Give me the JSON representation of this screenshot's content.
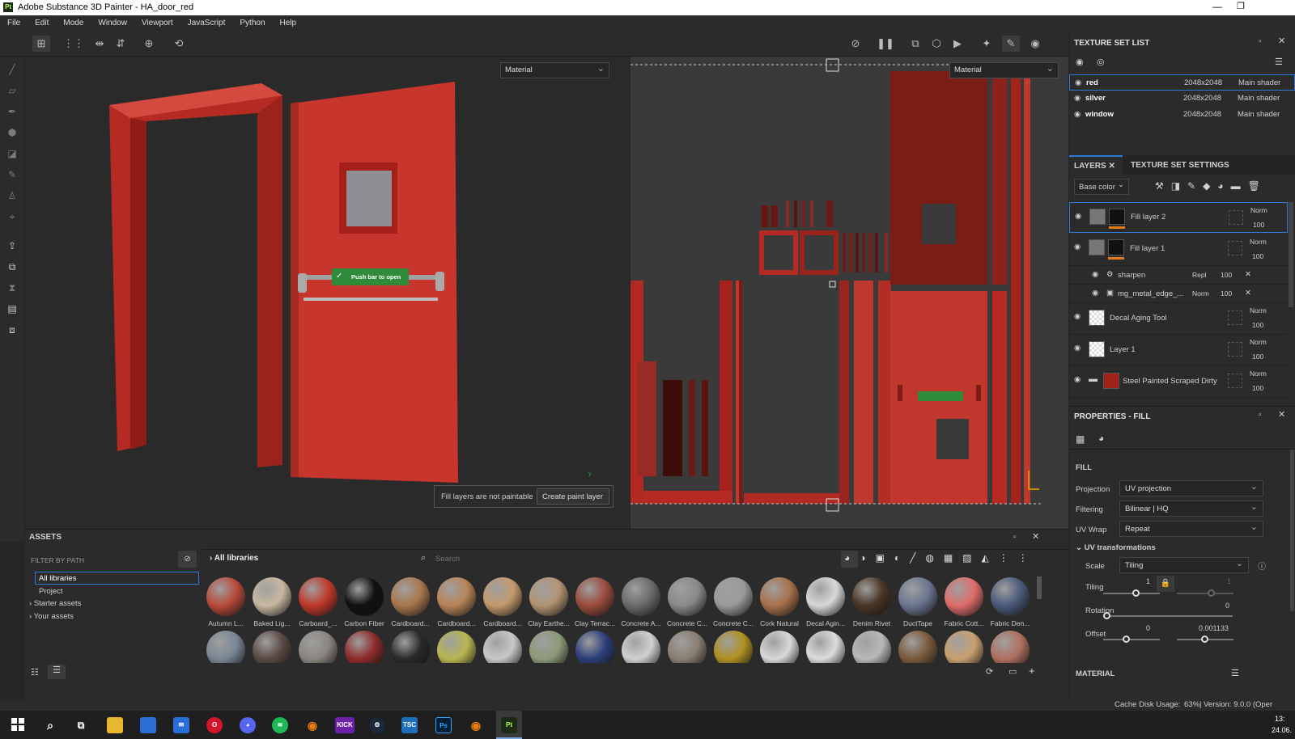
{
  "window": {
    "title": "Adobe Substance 3D Painter - HA_door_red",
    "logo_text": "Pt"
  },
  "menu": [
    "File",
    "Edit",
    "Mode",
    "Window",
    "Viewport",
    "JavaScript",
    "Python",
    "Help"
  ],
  "viewport": {
    "left_dropdown": "Material",
    "right_dropdown": "Material",
    "door_sign": "Push bar to open",
    "notice_text": "Fill layers are not paintable",
    "notice_button": "Create paint layer",
    "axis_y": "y"
  },
  "texture_set_list": {
    "title": "TEXTURE SET LIST",
    "rows": [
      {
        "name": "red",
        "size": "2048x2048",
        "shader": "Main shader"
      },
      {
        "name": "silver",
        "size": "2048x2048",
        "shader": "Main shader"
      },
      {
        "name": "window",
        "size": "2048x2048",
        "shader": "Main shader"
      }
    ]
  },
  "layers_panel": {
    "tab_layers": "LAYERS",
    "tab_settings": "TEXTURE SET SETTINGS",
    "channel": "Base color",
    "layers": [
      {
        "name": "Fill layer 2",
        "blend": "Norm",
        "opacity": "100"
      },
      {
        "name": "Fill layer 1",
        "blend": "Norm",
        "opacity": "100"
      },
      {
        "name": "sharpen",
        "blend": "Repl",
        "opacity": "100"
      },
      {
        "name": "mg_metal_edge_...",
        "blend": "Norm",
        "opacity": "100"
      },
      {
        "name": "Decal Aging Tool",
        "blend": "Norm",
        "opacity": "100"
      },
      {
        "name": "Layer 1",
        "blend": "Norm",
        "opacity": "100"
      },
      {
        "name": "Steel Painted Scraped Dirty",
        "blend": "Norm",
        "opacity": "100"
      }
    ]
  },
  "properties": {
    "title": "PROPERTIES - FILL",
    "section": "FILL",
    "projection_label": "Projection",
    "projection": "UV projection",
    "filtering_label": "Filtering",
    "filtering": "Bilinear | HQ",
    "uvwrap_label": "UV Wrap",
    "uvwrap": "Repeat",
    "uv_transform_title": "UV transformations",
    "scale_label": "Scale",
    "scale": "Tiling",
    "tiling_label": "Tiling",
    "tiling_value": "1",
    "tiling_value2": "1",
    "rotation_label": "Rotation",
    "rotation_value": "0",
    "offset_label": "Offset",
    "offset_u": "0",
    "offset_v": "0.001133",
    "material_title": "MATERIAL"
  },
  "assets": {
    "title": "ASSETS",
    "filter_label": "FILTER BY PATH",
    "tree": [
      "All libraries",
      "Project",
      "Starter assets",
      "Your assets"
    ],
    "breadcrumb": "All libraries",
    "search_placeholder": "Search",
    "row1": [
      {
        "name": "Autumn L...",
        "color": "#b84a3a"
      },
      {
        "name": "Baked Lig...",
        "color": "#c9b8a0"
      },
      {
        "name": "Carboard_...",
        "color": "#c0392b"
      },
      {
        "name": "Carbon Fiber",
        "color": "#111111"
      },
      {
        "name": "Cardboard...",
        "color": "#a9774c"
      },
      {
        "name": "Cardboard...",
        "color": "#b88458"
      },
      {
        "name": "Cardboard...",
        "color": "#c49a6c"
      },
      {
        "name": "Clay Earthe...",
        "color": "#b39473"
      },
      {
        "name": "Clay Terrac...",
        "color": "#9b4b3c"
      },
      {
        "name": "Concrete A...",
        "color": "#6b6b6b"
      },
      {
        "name": "Concrete C...",
        "color": "#8a8a8a"
      },
      {
        "name": "Concrete C...",
        "color": "#9a9a9a"
      },
      {
        "name": "Cork Natural",
        "color": "#a8714a"
      },
      {
        "name": "Decal Agin...",
        "color": "#d8d8d8"
      },
      {
        "name": "Denim Rivet",
        "color": "#4a3626"
      },
      {
        "name": "DuctTape",
        "color": "#6b7690"
      },
      {
        "name": "Fabric Cott...",
        "color": "#e06c6c"
      },
      {
        "name": "Fabric Den...",
        "color": "#4a5a7a"
      }
    ],
    "row2": [
      "#7a8695",
      "#5a4a45",
      "#8a8580",
      "#8f2b2b",
      "#2a2a2a",
      "#b9b650",
      "#c8c8c8",
      "#8d9a78",
      "#2c3f7a",
      "#d0d0d0",
      "#8a7f72",
      "#b09020",
      "#d8d8d8",
      "#dcdcdc",
      "#b8b8b8",
      "#7a5a3a",
      "#c8a070",
      "#b07060"
    ]
  },
  "status": {
    "cache_label": "Cache Disk Usage:",
    "cache_value": "63%",
    "version": "| Version: 9.0.0 (Oper"
  },
  "clock": {
    "time": "13:",
    "date": "24.06."
  },
  "taskbar": [
    {
      "icon": "search-icon",
      "color": "#1f1f1f"
    },
    {
      "icon": "taskview-icon",
      "color": "#1f1f1f"
    },
    {
      "icon": "explorer-icon",
      "color": "#e8b730"
    },
    {
      "icon": "store-icon",
      "color": "#2a6fd6"
    },
    {
      "icon": "mail-icon",
      "color": "#2a6fd6"
    },
    {
      "icon": "opera-icon",
      "color": "#d4142a"
    },
    {
      "icon": "discord-icon",
      "color": "#5865f2"
    },
    {
      "icon": "spotify-icon",
      "color": "#1db954"
    },
    {
      "icon": "blender-icon",
      "color": "#e87d0d"
    },
    {
      "icon": "kick-icon",
      "color": "#6b21a8"
    },
    {
      "icon": "steam-icon",
      "color": "#1b2838"
    },
    {
      "icon": "tsc-icon",
      "color": "#1d6fb8"
    },
    {
      "icon": "photoshop-icon",
      "color": "#001e36"
    },
    {
      "icon": "blender2-icon",
      "color": "#e87d0d"
    },
    {
      "icon": "painter-icon",
      "color": "#1d2b16"
    }
  ],
  "taskbar_labels": {
    "kick": "KICK",
    "tsc": "TSC",
    "ps": "Ps",
    "pt": "Pt"
  }
}
